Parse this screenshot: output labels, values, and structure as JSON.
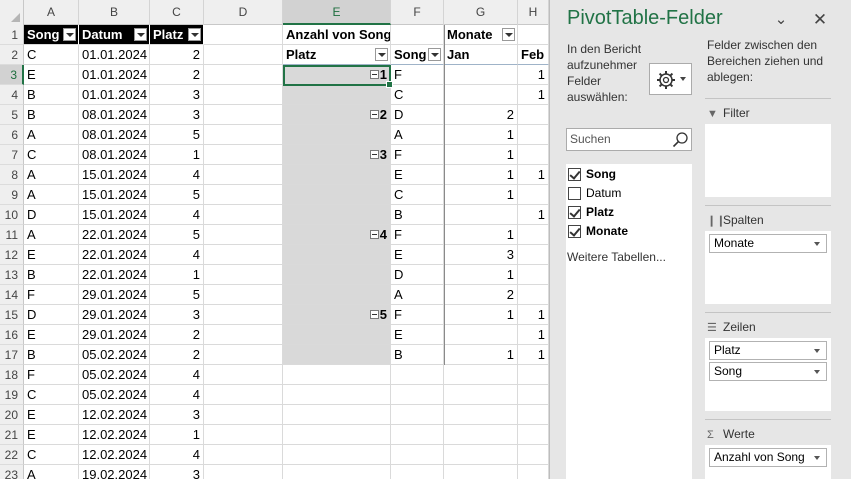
{
  "sheet": {
    "columns": [
      "A",
      "B",
      "C",
      "D",
      "E",
      "F",
      "G",
      "H"
    ],
    "row_numbers": [
      "1",
      "2",
      "3",
      "4",
      "5",
      "6",
      "7",
      "8",
      "9",
      "10",
      "11",
      "12",
      "13",
      "14",
      "15",
      "16",
      "17",
      "18",
      "19",
      "20",
      "21",
      "22",
      "23"
    ],
    "table_headers": [
      "Song",
      "Datum",
      "Platz"
    ],
    "table_rows": [
      [
        "C",
        "01.01.2024",
        "2"
      ],
      [
        "E",
        "01.01.2024",
        "2"
      ],
      [
        "B",
        "01.01.2024",
        "3"
      ],
      [
        "B",
        "08.01.2024",
        "3"
      ],
      [
        "A",
        "08.01.2024",
        "5"
      ],
      [
        "C",
        "08.01.2024",
        "1"
      ],
      [
        "A",
        "15.01.2024",
        "4"
      ],
      [
        "A",
        "15.01.2024",
        "5"
      ],
      [
        "D",
        "15.01.2024",
        "4"
      ],
      [
        "A",
        "22.01.2024",
        "5"
      ],
      [
        "E",
        "22.01.2024",
        "4"
      ],
      [
        "B",
        "22.01.2024",
        "1"
      ],
      [
        "F",
        "29.01.2024",
        "5"
      ],
      [
        "D",
        "29.01.2024",
        "3"
      ],
      [
        "E",
        "29.01.2024",
        "2"
      ],
      [
        "B",
        "05.02.2024",
        "2"
      ],
      [
        "F",
        "05.02.2024",
        "4"
      ],
      [
        "C",
        "05.02.2024",
        "4"
      ],
      [
        "E",
        "12.02.2024",
        "3"
      ],
      [
        "E",
        "12.02.2024",
        "1"
      ],
      [
        "C",
        "12.02.2024",
        "4"
      ],
      [
        "A",
        "19.02.2024",
        "3"
      ]
    ],
    "pivot": {
      "value_header": "Anzahl von Song",
      "columns_header": "Monate",
      "row_header_platz": "Platz",
      "row_header_song": "Song",
      "month_labels": [
        "Jan",
        "Feb"
      ],
      "rows": [
        {
          "platz": "1",
          "song": "F",
          "jan": "",
          "feb": "1"
        },
        {
          "platz": "",
          "song": "C",
          "jan": "",
          "feb": "1"
        },
        {
          "platz": "2",
          "song": "D",
          "jan": "2",
          "feb": ""
        },
        {
          "platz": "",
          "song": "A",
          "jan": "1",
          "feb": ""
        },
        {
          "platz": "3",
          "song": "F",
          "jan": "1",
          "feb": ""
        },
        {
          "platz": "",
          "song": "E",
          "jan": "1",
          "feb": "1"
        },
        {
          "platz": "",
          "song": "C",
          "jan": "1",
          "feb": ""
        },
        {
          "platz": "",
          "song": "B",
          "jan": "",
          "feb": "1"
        },
        {
          "platz": "4",
          "song": "F",
          "jan": "1",
          "feb": ""
        },
        {
          "platz": "",
          "song": "E",
          "jan": "3",
          "feb": ""
        },
        {
          "platz": "",
          "song": "D",
          "jan": "1",
          "feb": ""
        },
        {
          "platz": "",
          "song": "A",
          "jan": "2",
          "feb": ""
        },
        {
          "platz": "5",
          "song": "F",
          "jan": "1",
          "feb": "1"
        },
        {
          "platz": "",
          "song": "E",
          "jan": "",
          "feb": "1"
        },
        {
          "platz": "",
          "song": "B",
          "jan": "1",
          "feb": "1"
        }
      ]
    }
  },
  "panel": {
    "title": "PivotTable-Felder",
    "choose_fields_text": "In den Bericht aufzunehmer Felder auswählen:",
    "search_placeholder": "Suchen",
    "fields": [
      {
        "label": "Song",
        "checked": true
      },
      {
        "label": "Datum",
        "checked": false
      },
      {
        "label": "Platz",
        "checked": true
      },
      {
        "label": "Monate",
        "checked": true
      }
    ],
    "more_tables": "Weitere Tabellen...",
    "drag_text": "Felder zwischen den Bereichen ziehen und ablegen:",
    "areas": {
      "filter": {
        "label": "Filter",
        "items": []
      },
      "columns": {
        "label": "Spalten",
        "items": [
          "Monate"
        ]
      },
      "rows": {
        "label": "Zeilen",
        "items": [
          "Platz",
          "Song"
        ]
      },
      "values": {
        "label": "Werte",
        "items": [
          "Anzahl von Song"
        ]
      }
    },
    "icons": [
      "dropdown-icon",
      "close-icon",
      "gear-icon",
      "search-icon",
      "filter-icon",
      "columns-icon",
      "rows-icon",
      "sigma-icon"
    ]
  }
}
